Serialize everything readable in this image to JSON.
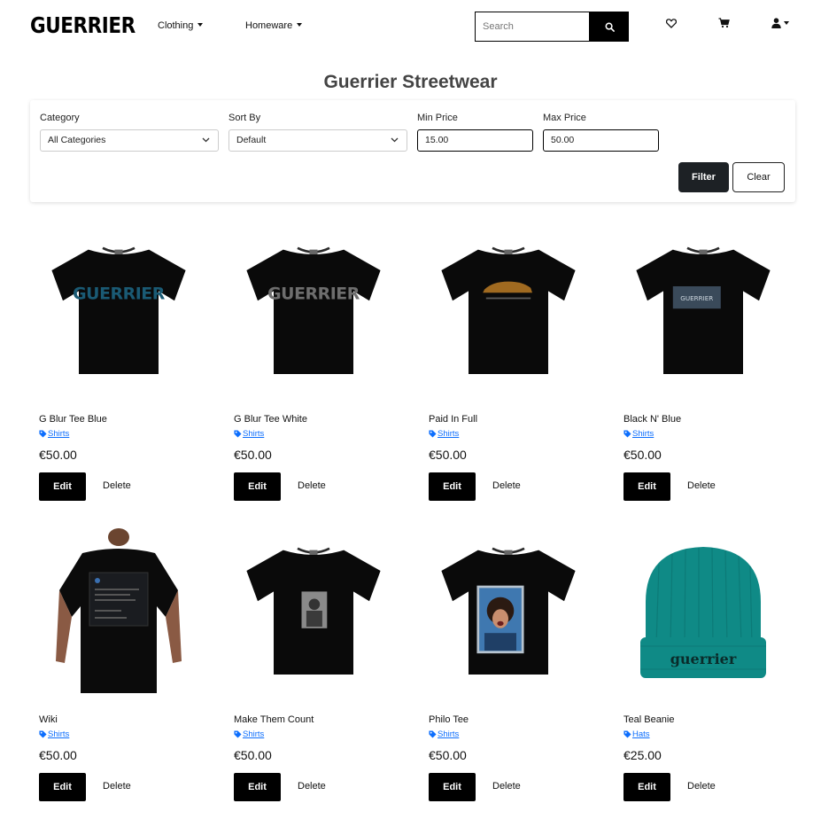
{
  "nav": {
    "logo": "GUERRIER",
    "links": [
      {
        "label": "Clothing"
      },
      {
        "label": "Homeware"
      }
    ],
    "search_placeholder": "Search",
    "icons": [
      "heart-icon",
      "cart-icon",
      "user-icon"
    ]
  },
  "page": {
    "title": "Guerrier Streetwear"
  },
  "filter": {
    "category_label": "Category",
    "category_value": "All Categories",
    "sort_label": "Sort By",
    "sort_value": "Default",
    "min_label": "Min Price",
    "min_value": "15.00",
    "max_label": "Max Price",
    "max_value": "50.00",
    "filter_button": "Filter",
    "clear_button": "Clear"
  },
  "products": [
    {
      "name": "G Blur Tee Blue",
      "category": "Shirts",
      "price": "€50.00",
      "edit": "Edit",
      "delete": "Delete",
      "image": "tshirt-blue-logo",
      "print_text": "GUERRIER",
      "print_color": "#1a5a74"
    },
    {
      "name": "G Blur Tee White",
      "category": "Shirts",
      "price": "€50.00",
      "edit": "Edit",
      "delete": "Delete",
      "image": "tshirt-grey-logo",
      "print_text": "GUERRIER",
      "print_color": "#6e6e6e"
    },
    {
      "name": "Paid In Full",
      "category": "Shirts",
      "price": "€50.00",
      "edit": "Edit",
      "delete": "Delete",
      "image": "tshirt-car-print",
      "print_color": "#a06a20"
    },
    {
      "name": "Black N' Blue",
      "category": "Shirts",
      "price": "€50.00",
      "edit": "Edit",
      "delete": "Delete",
      "image": "tshirt-box-print",
      "print_text": "GUERRIER",
      "print_color": "#3a4a5a"
    },
    {
      "name": "Wiki",
      "category": "Shirts",
      "price": "€50.00",
      "edit": "Edit",
      "delete": "Delete",
      "image": "model-back-tshirt"
    },
    {
      "name": "Make Them Count",
      "category": "Shirts",
      "price": "€50.00",
      "edit": "Edit",
      "delete": "Delete",
      "image": "tshirt-photo-print"
    },
    {
      "name": "Philo Tee",
      "category": "Shirts",
      "price": "€50.00",
      "edit": "Edit",
      "delete": "Delete",
      "image": "tshirt-portrait-print",
      "print_color": "#3f78b0"
    },
    {
      "name": "Teal Beanie",
      "category": "Hats",
      "price": "€25.00",
      "edit": "Edit",
      "delete": "Delete",
      "image": "teal-beanie",
      "print_text": "guerrier",
      "print_color": "#0f8a86"
    }
  ]
}
